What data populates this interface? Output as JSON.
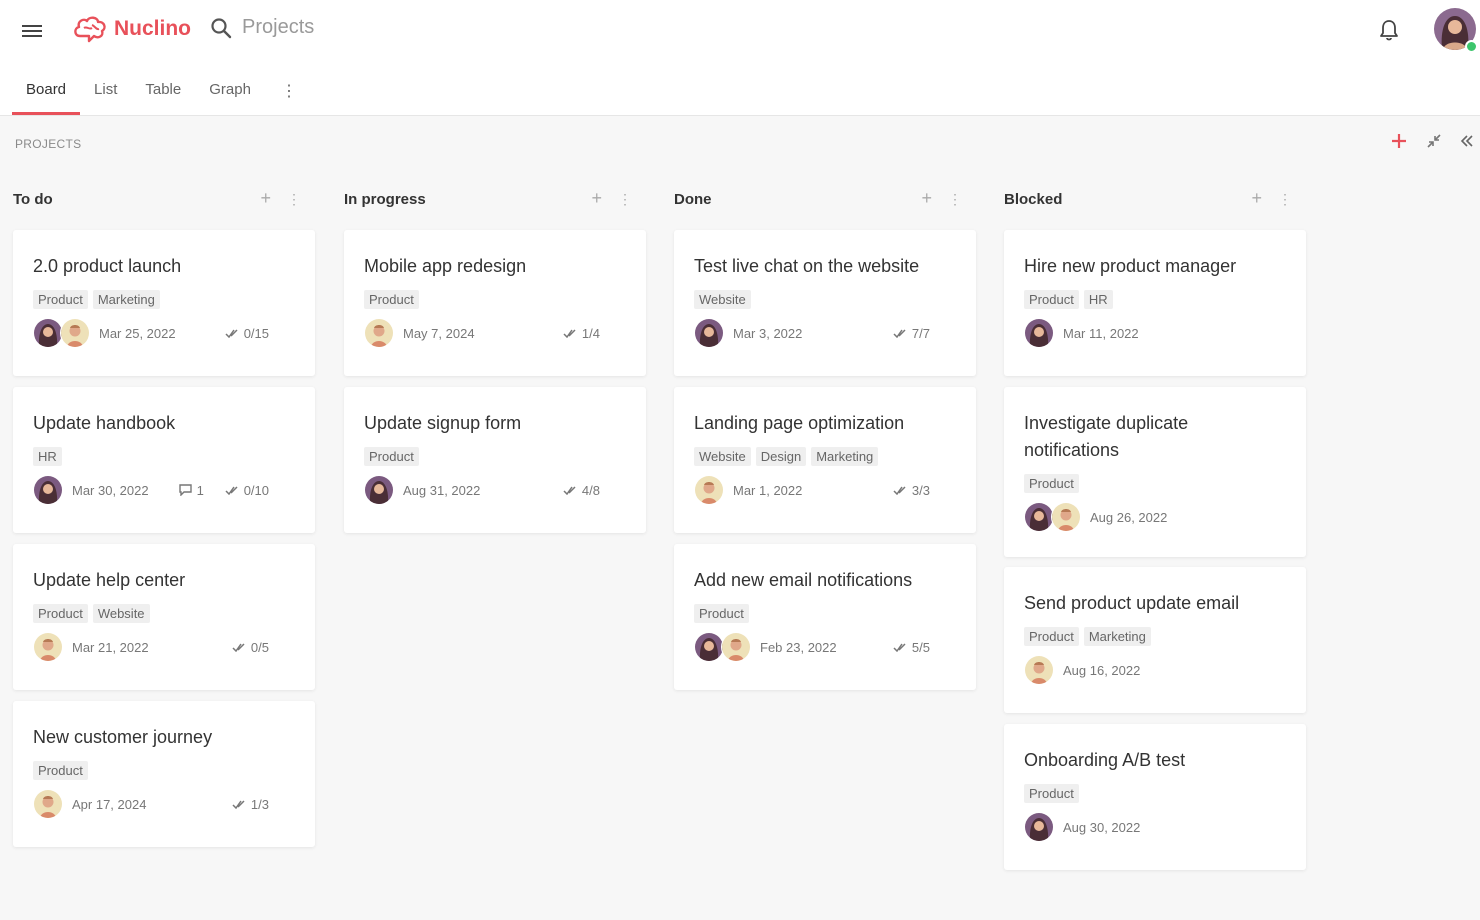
{
  "app": {
    "brand": "Nuclino",
    "search_label": "Projects"
  },
  "tabs": [
    {
      "label": "Board"
    },
    {
      "label": "List"
    },
    {
      "label": "Table"
    },
    {
      "label": "Graph"
    }
  ],
  "section_label": "PROJECTS",
  "columns": [
    {
      "title": "To do",
      "cards": [
        {
          "title": "2.0 product launch",
          "tags": [
            "Product",
            "Marketing"
          ],
          "date": "Mar 25, 2022",
          "progress": "0/15"
        },
        {
          "title": "Update handbook",
          "tags": [
            "HR"
          ],
          "date": "Mar 30, 2022",
          "comments": "1",
          "progress": "0/10"
        },
        {
          "title": "Update help center",
          "tags": [
            "Product",
            "Website"
          ],
          "date": "Mar 21, 2022",
          "progress": "0/5"
        },
        {
          "title": "New customer journey",
          "tags": [
            "Product"
          ],
          "date": "Apr 17, 2024",
          "progress": "1/3"
        }
      ]
    },
    {
      "title": "In progress",
      "cards": [
        {
          "title": "Mobile app redesign",
          "tags": [
            "Product"
          ],
          "date": "May 7, 2024",
          "progress": "1/4"
        },
        {
          "title": "Update signup form",
          "tags": [
            "Product"
          ],
          "date": "Aug 31, 2022",
          "progress": "4/8"
        }
      ]
    },
    {
      "title": "Done",
      "cards": [
        {
          "title": "Test live chat on the website",
          "tags": [
            "Website"
          ],
          "date": "Mar 3, 2022",
          "progress": "7/7"
        },
        {
          "title": "Landing page optimization",
          "tags": [
            "Website",
            "Design",
            "Marketing"
          ],
          "date": "Mar 1, 2022",
          "progress": "3/3"
        },
        {
          "title": "Add new email notifications",
          "tags": [
            "Product"
          ],
          "date": "Feb 23, 2022",
          "progress": "5/5"
        }
      ]
    },
    {
      "title": "Blocked",
      "cards": [
        {
          "title": "Hire new product manager",
          "tags": [
            "Product",
            "HR"
          ],
          "date": "Mar 11, 2022"
        },
        {
          "title": "Investigate duplicate notifications",
          "tags": [
            "Product"
          ],
          "date": "Aug 26, 2022"
        },
        {
          "title": "Send product update email",
          "tags": [
            "Product",
            "Marketing"
          ],
          "date": "Aug 16, 2022"
        },
        {
          "title": "Onboarding A/B test",
          "tags": [
            "Product"
          ],
          "date": "Aug 30, 2022"
        }
      ]
    }
  ],
  "colors": {
    "accent": "#e8515a",
    "online": "#3cc56c"
  }
}
